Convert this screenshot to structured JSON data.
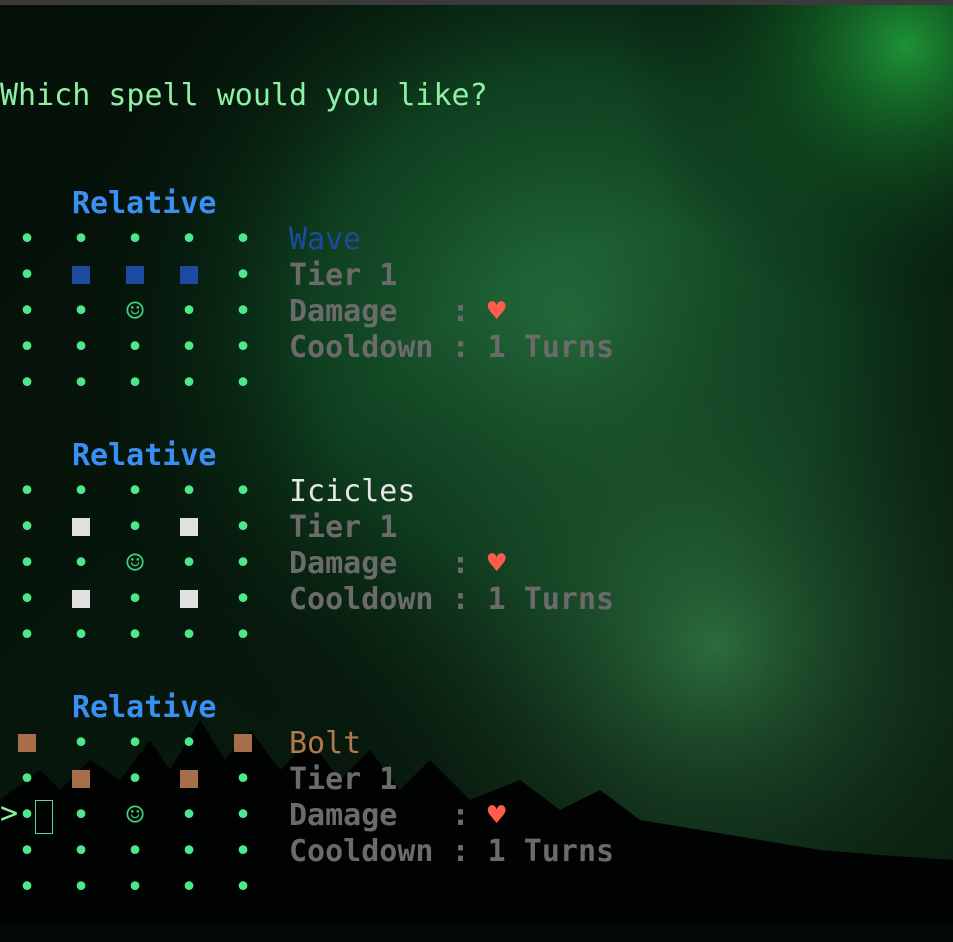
{
  "prompt": {
    "question": "Which spell would you like?",
    "caret": ">"
  },
  "spells": [
    {
      "mode": "Relative",
      "name": "Wave",
      "name_color": "#1c4aa0",
      "tile_color": "#1c4aa0",
      "tier": "Tier 1",
      "damage_label": "Damage   :",
      "damage_value": "♥",
      "cooldown": "Cooldown : 1 Turns",
      "grid": [
        ".....",
        ".###.",
        "..@..",
        ".....",
        "....."
      ]
    },
    {
      "mode": "Relative",
      "name": "Icicles",
      "name_color": "#e6e6e6",
      "tile_color": "#e0e0e0",
      "tier": "Tier 1",
      "damage_label": "Damage   :",
      "damage_value": "♥",
      "cooldown": "Cooldown : 1 Turns",
      "grid": [
        ".....",
        ".#.#.",
        "..@..",
        ".#.#.",
        "....."
      ]
    },
    {
      "mode": "Relative",
      "name": "Bolt",
      "name_color": "#b07a4e",
      "tile_color": "#a66f4a",
      "tier": "Tier 1",
      "damage_label": "Damage   :",
      "damage_value": "♥",
      "cooldown": "Cooldown : 1 Turns",
      "grid": [
        "#...#",
        ".#.#.",
        "..@..",
        ".....",
        "....."
      ]
    }
  ],
  "colors": {
    "dot": "#4ee88a",
    "relative_label": "#3a8ff2",
    "heart": "#ff5c4d",
    "info_text": "#6b6b6b"
  }
}
